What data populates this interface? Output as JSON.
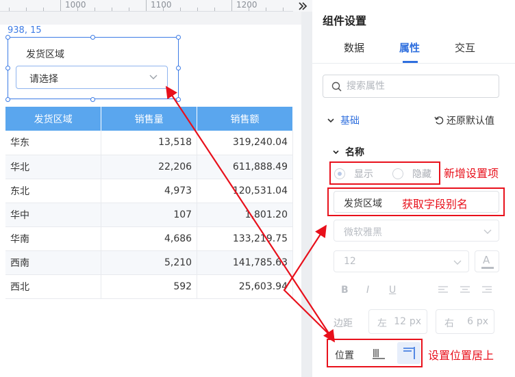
{
  "ruler": {
    "labels": [
      "1000",
      "1100",
      "1200"
    ],
    "expand_icon": "double-chevron-right-icon"
  },
  "canvas": {
    "coord_readout": "938, 15",
    "widget": {
      "label": "发货区域",
      "placeholder": "请选择"
    }
  },
  "table": {
    "headers": [
      "发货区域",
      "销售量",
      "销售额"
    ],
    "rows": [
      [
        "华东",
        "13,518",
        "319,240.04"
      ],
      [
        "华北",
        "22,206",
        "611,888.49"
      ],
      [
        "东北",
        "4,973",
        "120,531.04"
      ],
      [
        "华中",
        "107",
        "1,801.20"
      ],
      [
        "华南",
        "4,686",
        "133,219.75"
      ],
      [
        "西南",
        "5,210",
        "141,785.63"
      ],
      [
        "西北",
        "592",
        "25,603.94"
      ]
    ]
  },
  "panel": {
    "title": "组件设置",
    "tabs": [
      "数据",
      "属性",
      "交互"
    ],
    "active_tab": "属性",
    "search_placeholder": "搜索属性",
    "section_basic": "基础",
    "reset_default": "还原默认值",
    "name_section": "名称",
    "radio_show": "显示",
    "radio_hide": "隐藏",
    "field_value": "发货区域",
    "font_family": "微软雅黑",
    "font_size": "12",
    "style_buttons": [
      "B",
      "I",
      "U"
    ],
    "margin_label": "边距",
    "margin_left_label": "左",
    "margin_left_value": "12",
    "margin_right_label": "右",
    "margin_right_value": "6",
    "unit": "px",
    "position_label": "位置"
  },
  "annotations": {
    "new_setting": "新增设置项",
    "get_alias": "获取字段别名",
    "set_position_top": "设置位置居上"
  },
  "colors": {
    "accent": "#2f6fde",
    "header_blue": "#5aa6ee",
    "annotation_red": "#e8101b"
  }
}
